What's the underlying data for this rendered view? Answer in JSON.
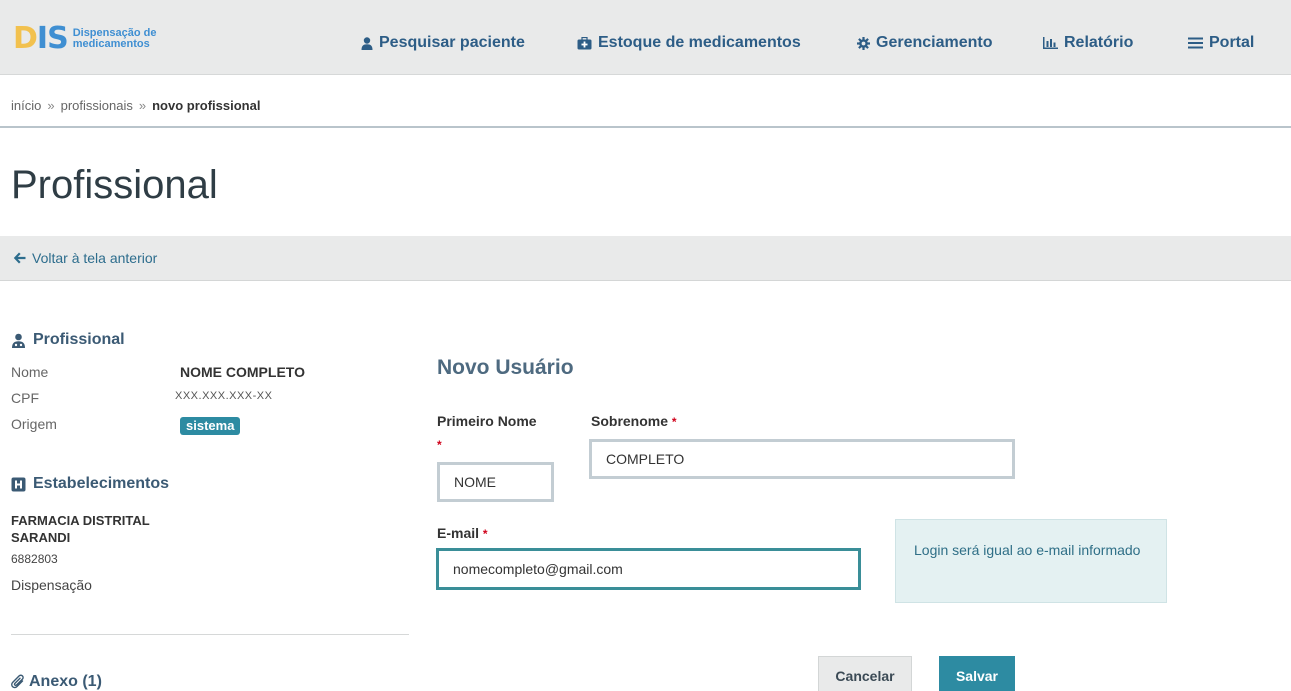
{
  "app": {
    "logo_mark_d": "D",
    "logo_mark_is": "IS",
    "logo_line1": "Dispensação de",
    "logo_line2": "medicamentos"
  },
  "nav": {
    "items": [
      {
        "label": "Pesquisar paciente",
        "icon": "user-icon"
      },
      {
        "label": "Estoque de medicamentos",
        "icon": "medkit-icon"
      },
      {
        "label": "Gerenciamento",
        "icon": "gear-icon"
      },
      {
        "label": "Relatório",
        "icon": "bar-chart-icon"
      },
      {
        "label": "Portal",
        "icon": "menu-icon"
      }
    ]
  },
  "breadcrumb": {
    "items": [
      "início",
      "profissionais",
      "novo profissional"
    ],
    "separator": "»"
  },
  "page": {
    "title": "Profissional",
    "back_label": "Voltar à tela anterior"
  },
  "professional": {
    "heading": "Profissional",
    "fields": [
      {
        "label": "Nome",
        "value": "NOME COMPLETO"
      },
      {
        "label": "CPF",
        "value": "XXX.XXX.XXX-XX"
      },
      {
        "label": "Origem",
        "value": "sistema"
      }
    ]
  },
  "establishments": {
    "heading": "Estabelecimentos",
    "name": "FARMACIA DISTRITAL SARANDI",
    "code": "6882803",
    "type": "Dispensação"
  },
  "annex": {
    "label": "Anexo (1)"
  },
  "form": {
    "title": "Novo Usuário",
    "first_name_label": "Primeiro Nome",
    "first_name_value": "NOME",
    "last_name_label": "Sobrenome",
    "last_name_value": "COMPLETO",
    "email_label": "E-mail",
    "email_value": "nomecompleto@gmail.com",
    "required_mark": "*",
    "info_text": "Login será igual ao e-mail informado",
    "cancel_label": "Cancelar",
    "save_label": "Salvar"
  },
  "colors": {
    "primary": "#2d8ba2",
    "nav_text": "#2d5d86",
    "required": "#d0021b",
    "navbar_bg": "#e9eaea"
  }
}
